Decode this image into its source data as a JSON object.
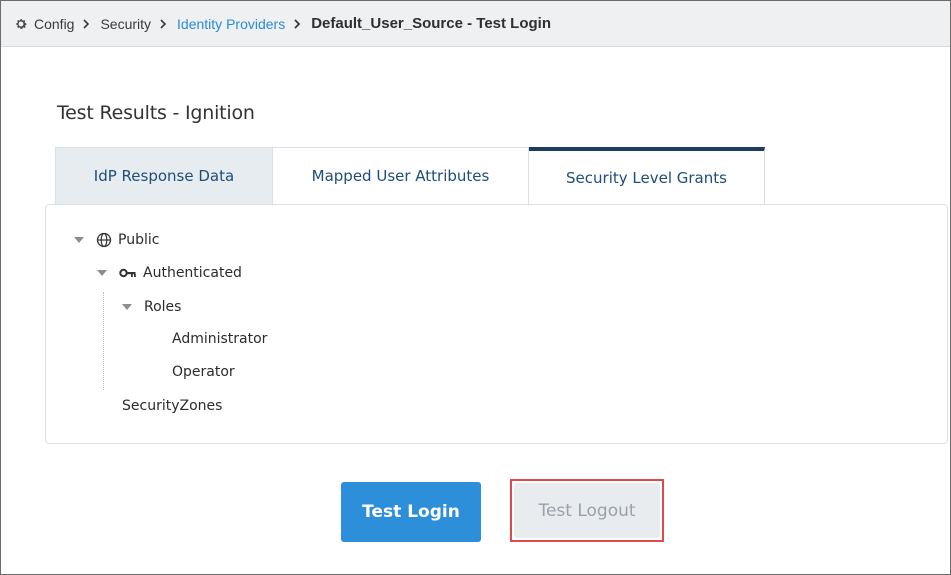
{
  "breadcrumb": {
    "items": [
      "Config",
      "Security",
      "Identity Providers"
    ],
    "current": "Default_User_Source - Test Login"
  },
  "results_title": "Test Results - Ignition",
  "tabs": [
    {
      "label": "IdP Response Data",
      "active": false
    },
    {
      "label": "Mapped User Attributes",
      "active": false
    },
    {
      "label": "Security Level Grants",
      "active": true
    }
  ],
  "tree": {
    "public": "Public",
    "authenticated": "Authenticated",
    "roles": "Roles",
    "role_items": [
      "Administrator",
      "Operator"
    ],
    "security_zones": "SecurityZones"
  },
  "buttons": {
    "test_login": "Test Login",
    "test_logout": "Test Logout"
  },
  "colors": {
    "link": "#2a8bd6",
    "primary_button": "#2d8fd9",
    "active_tab_border": "#1c3d5e",
    "highlight": "#e04a4a"
  },
  "icons": {
    "breadcrumb": "gear-icon",
    "public": "globe-icon",
    "authenticated": "key-icon",
    "separator": "chevron-right-icon"
  }
}
